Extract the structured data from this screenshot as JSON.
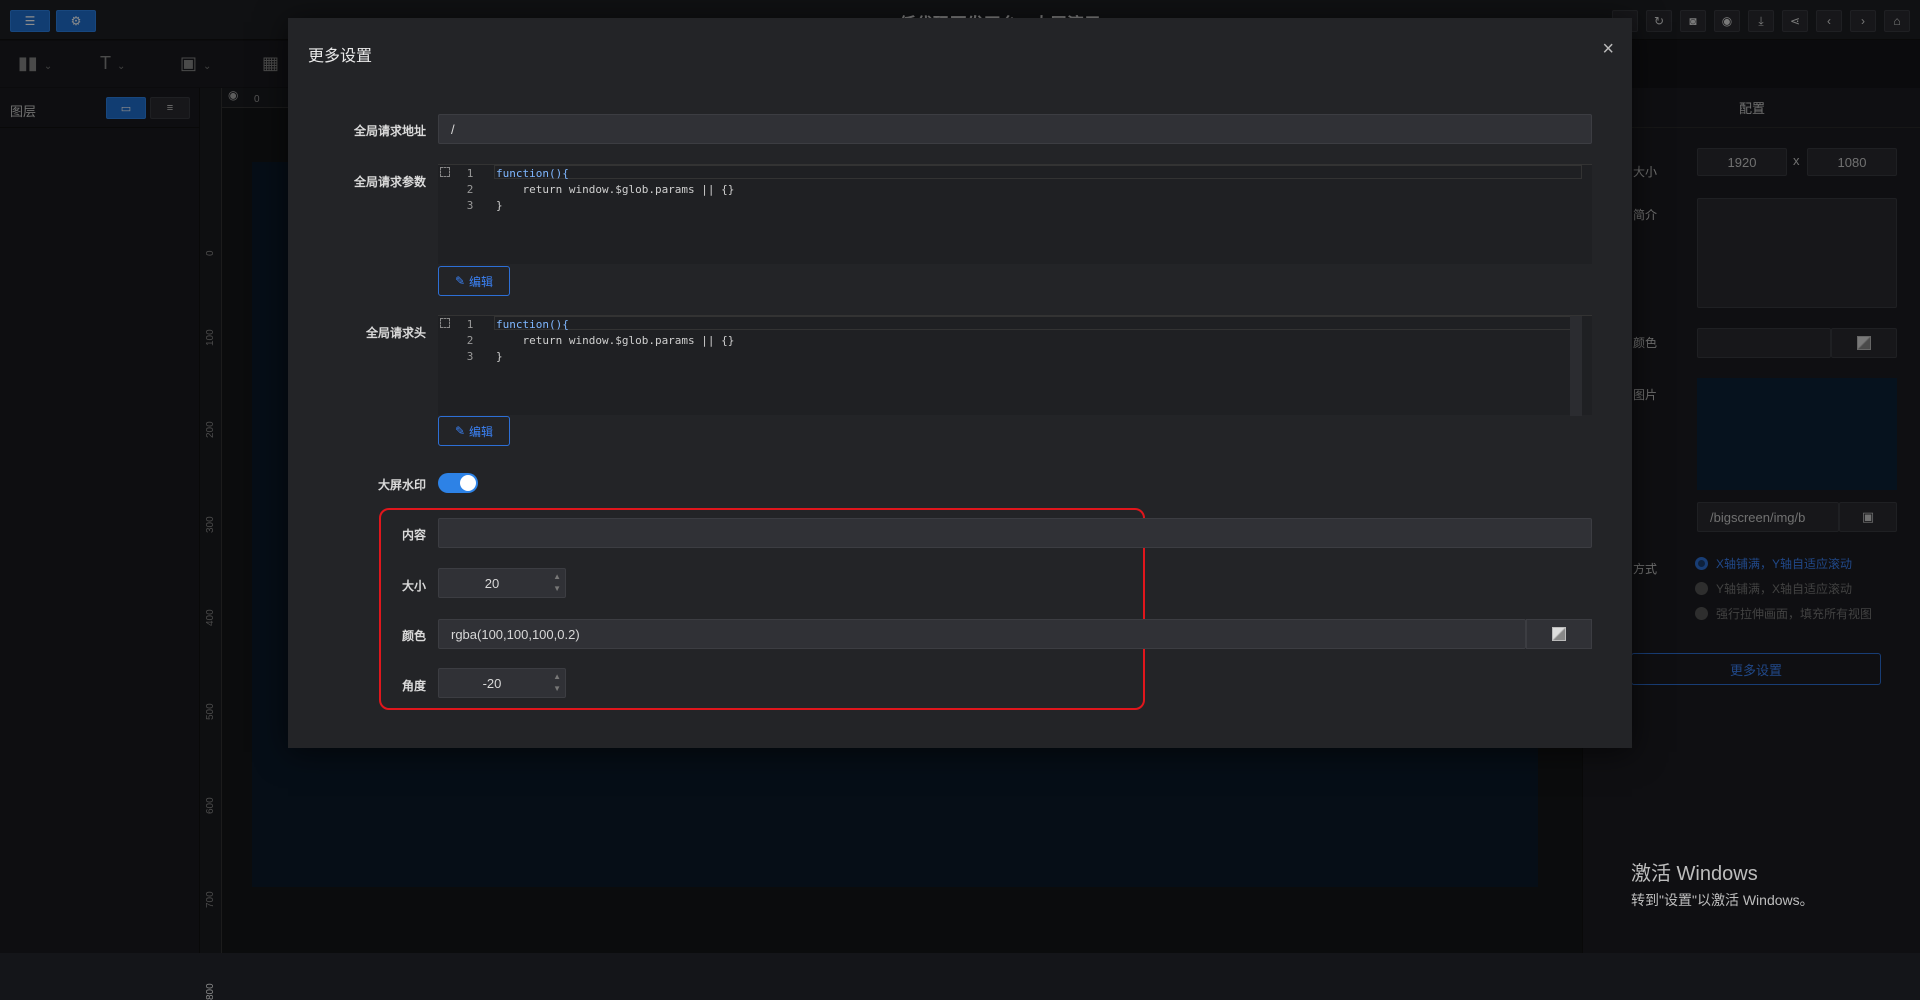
{
  "app": {
    "title": "MISBoot低代码开发平台 - 大屏演示"
  },
  "layer_panel": {
    "title": "图层"
  },
  "ruler": {
    "top_zero": "0",
    "left_ticks": [
      "0",
      "100",
      "200",
      "300",
      "400",
      "500",
      "600",
      "700",
      "800"
    ]
  },
  "right_panel": {
    "tab": "配置",
    "size_label": "大小",
    "width": "1920",
    "x_sep": "x",
    "height": "1080",
    "intro_label": "简介",
    "color_label": "颜色",
    "image_label": "图片",
    "image_path": "/bigscreen/img/b",
    "mode_label": "方式",
    "modes": [
      "X轴铺满，Y轴自适应滚动",
      "Y轴铺满，X轴自适应滚动",
      "强行拉伸画面，填充所有视图"
    ],
    "more_settings": "更多设置"
  },
  "windows_notice": {
    "line1": "激活 Windows",
    "line2": "转到\"设置\"以激活 Windows。"
  },
  "modal": {
    "title": "更多设置",
    "close": "×",
    "global_url_label": "全局请求地址",
    "global_url_value": "/",
    "global_params_label": "全局请求参数",
    "global_headers_label": "全局请求头",
    "code_lines": {
      "n1": "1",
      "n2": "2",
      "n3": "3",
      "l1": "function(){",
      "l2": "    return window.$glob.params || {}",
      "l3": "}"
    },
    "edit_label": "编辑",
    "watermark_label": "大屏水印",
    "content_label": "内容",
    "content_value": "",
    "size_label": "大小",
    "size_value": "20",
    "color_label": "颜色",
    "color_value": "rgba(100,100,100,0.2)",
    "angle_label": "角度",
    "angle_value": "-20"
  },
  "colors": {
    "accent": "#2d82e6",
    "highlight": "#e0161c"
  }
}
